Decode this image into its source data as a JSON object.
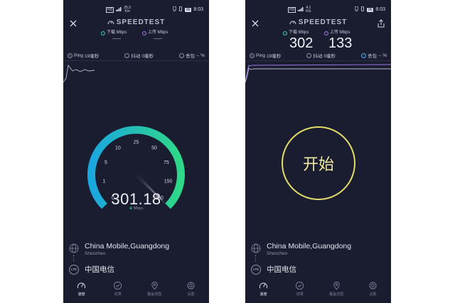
{
  "colors": {
    "background": "#1a1c30",
    "download": "#3ad29f",
    "upload": "#a57cf0",
    "gauge_start": "#1aa7e0",
    "gauge_end": "#2fd886",
    "start_ring": "#e3dd6a"
  },
  "left": {
    "status": {
      "net": "HD",
      "speed_value": "25.3",
      "speed_unit": "K/s",
      "battery": "96",
      "time": "8:03"
    },
    "brand": "SPEEDTEST",
    "download_label": "下载 Mbps",
    "upload_label": "上传 Mbps",
    "ping_label": "Ping",
    "ping_value": "19毫秒",
    "jitter_label": "抖动",
    "jitter_value": "0毫秒",
    "loss_label": "丢包",
    "loss_value": "-- %",
    "gauge": {
      "ticks": [
        "0",
        "1",
        "5",
        "10",
        "25",
        "50",
        "75",
        "150",
        "300"
      ],
      "needle_value": 301.18,
      "value": "301.18",
      "unit": "Mbps"
    }
  },
  "right": {
    "status": {
      "net": "HD",
      "speed_value": "4.1",
      "speed_unit": "K/s",
      "battery": "96",
      "time": "8:03"
    },
    "brand": "SPEEDTEST",
    "download_label": "下载 Mbps",
    "upload_label": "上传 Mbps",
    "download_value": "302",
    "upload_value": "133",
    "ping_label": "Ping",
    "ping_value": "19毫秒",
    "jitter_label": "抖动",
    "jitter_value": "0毫秒",
    "loss_label": "丢包",
    "loss_value": "-- %",
    "start_label": "开始"
  },
  "provider": {
    "name": "China Mobile,Guangdong",
    "city": "Shenzhen"
  },
  "carrier": {
    "badge": "LTE",
    "name": "中国电信"
  },
  "nav": [
    {
      "label": "速度",
      "icon": "speedometer-icon",
      "active": true
    },
    {
      "label": "结果",
      "icon": "check-circle-icon",
      "active": false
    },
    {
      "label": "覆盖范围",
      "icon": "map-pin-icon",
      "active": false
    },
    {
      "label": "设置",
      "icon": "gear-icon",
      "active": false
    }
  ]
}
